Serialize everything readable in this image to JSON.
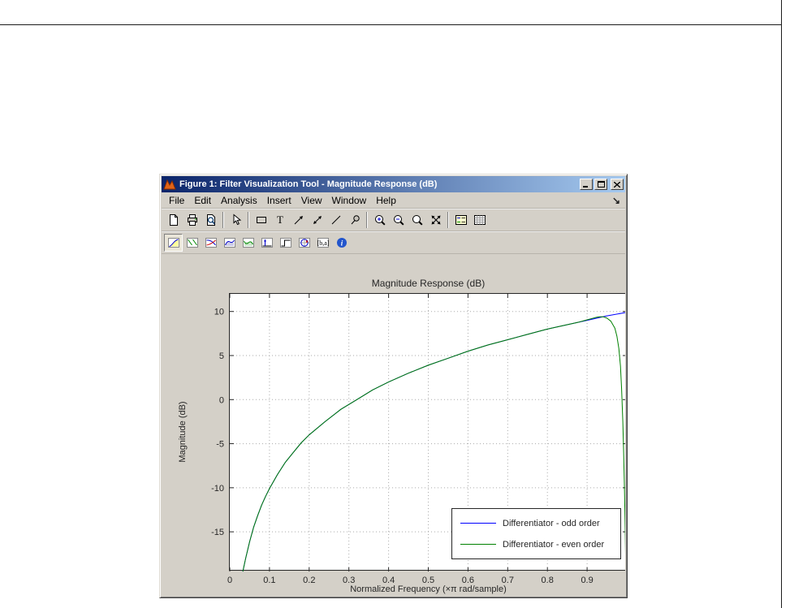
{
  "page": {
    "background": "#ffffff",
    "border_color": "#1c1c1c"
  },
  "window": {
    "title": "Figure 1: Filter Visualization Tool - Magnitude Response (dB)",
    "controls": {
      "minimize": "Minimize",
      "maximize": "Maximize",
      "close": "Close"
    },
    "titlebar_colors": {
      "left": "#0a246a",
      "right": "#a6caf0"
    }
  },
  "menubar": {
    "items": [
      "File",
      "Edit",
      "Analysis",
      "Insert",
      "View",
      "Window",
      "Help"
    ],
    "dock_arrow": "↘"
  },
  "toolbar_main": {
    "buttons": [
      "new-file",
      "print",
      "print-preview",
      "edit-plot-pointer",
      "insert-rectangle",
      "insert-text",
      "insert-arrow",
      "insert-double-arrow",
      "insert-line",
      "pin-to-axes",
      "zoom-in",
      "zoom-out",
      "zoom",
      "full-view",
      "legend-toggle",
      "grid-toggle"
    ]
  },
  "toolbar_analysis": {
    "buttons": [
      "magnitude-response",
      "phase-response",
      "magnitude-and-phase",
      "group-delay",
      "phase-delay",
      "impulse-response",
      "step-response",
      "pole-zero",
      "filter-coefficients",
      "filter-information"
    ],
    "active": "magnitude-response"
  },
  "chart_data": {
    "type": "line",
    "title": "Magnitude Response (dB)",
    "xlabel": "Normalized Frequency (×π rad/sample)",
    "ylabel": "Magnitude (dB)",
    "xlim": [
      0,
      1
    ],
    "ylim": [
      -19.5,
      12
    ],
    "xticks": [
      "0",
      "0.1",
      "0.2",
      "0.3",
      "0.4",
      "0.5",
      "0.6",
      "0.7",
      "0.8",
      "0.9"
    ],
    "yticks": [
      "10",
      "5",
      "0",
      "-5",
      "-10",
      "-15"
    ],
    "grid": true,
    "grid_color": "#aaaaaa",
    "legend": {
      "position": "lower right",
      "entries": [
        {
          "label": "Differentiator - odd order",
          "color": "#0000ff"
        },
        {
          "label": "Differentiator - even order",
          "color": "#008000"
        }
      ]
    },
    "series": [
      {
        "name": "Differentiator - odd order",
        "color": "#0000ff",
        "points": [
          [
            0.033,
            -19.5
          ],
          [
            0.04,
            -18
          ],
          [
            0.05,
            -16.1
          ],
          [
            0.06,
            -14.5
          ],
          [
            0.07,
            -13.2
          ],
          [
            0.08,
            -12
          ],
          [
            0.09,
            -11
          ],
          [
            0.1,
            -10.1
          ],
          [
            0.12,
            -8.5
          ],
          [
            0.14,
            -7.1
          ],
          [
            0.16,
            -6
          ],
          [
            0.18,
            -4.9
          ],
          [
            0.2,
            -4
          ],
          [
            0.24,
            -2.5
          ],
          [
            0.28,
            -1.1
          ],
          [
            0.32,
            0
          ],
          [
            0.36,
            1.1
          ],
          [
            0.4,
            2
          ],
          [
            0.45,
            3
          ],
          [
            0.5,
            3.9
          ],
          [
            0.55,
            4.7
          ],
          [
            0.6,
            5.5
          ],
          [
            0.65,
            6.2
          ],
          [
            0.7,
            6.8
          ],
          [
            0.75,
            7.4
          ],
          [
            0.8,
            8
          ],
          [
            0.85,
            8.5
          ],
          [
            0.9,
            9
          ],
          [
            0.95,
            9.5
          ],
          [
            1,
            9.9
          ]
        ]
      },
      {
        "name": "Differentiator - even order",
        "color": "#008000",
        "points": [
          [
            0.033,
            -19.5
          ],
          [
            0.04,
            -18
          ],
          [
            0.05,
            -16.1
          ],
          [
            0.06,
            -14.5
          ],
          [
            0.07,
            -13.2
          ],
          [
            0.08,
            -12
          ],
          [
            0.09,
            -11
          ],
          [
            0.1,
            -10.1
          ],
          [
            0.12,
            -8.5
          ],
          [
            0.14,
            -7.1
          ],
          [
            0.16,
            -6
          ],
          [
            0.18,
            -4.9
          ],
          [
            0.2,
            -4
          ],
          [
            0.24,
            -2.5
          ],
          [
            0.28,
            -1.1
          ],
          [
            0.32,
            0
          ],
          [
            0.36,
            1.1
          ],
          [
            0.4,
            2
          ],
          [
            0.45,
            3
          ],
          [
            0.5,
            3.9
          ],
          [
            0.55,
            4.7
          ],
          [
            0.6,
            5.5
          ],
          [
            0.65,
            6.2
          ],
          [
            0.7,
            6.8
          ],
          [
            0.75,
            7.4
          ],
          [
            0.8,
            8
          ],
          [
            0.85,
            8.5
          ],
          [
            0.88,
            8.8
          ],
          [
            0.9,
            9.05
          ],
          [
            0.92,
            9.3
          ],
          [
            0.93,
            9.4
          ],
          [
            0.94,
            9.4
          ],
          [
            0.95,
            9.25
          ],
          [
            0.96,
            8.9
          ],
          [
            0.97,
            8.1
          ],
          [
            0.975,
            7.2
          ],
          [
            0.98,
            5.8
          ],
          [
            0.984,
            3.8
          ],
          [
            0.987,
            1.2
          ],
          [
            0.99,
            -2.5
          ],
          [
            0.992,
            -6
          ],
          [
            0.994,
            -10
          ],
          [
            0.996,
            -14.5
          ],
          [
            0.9975,
            -19.5
          ]
        ]
      }
    ]
  }
}
